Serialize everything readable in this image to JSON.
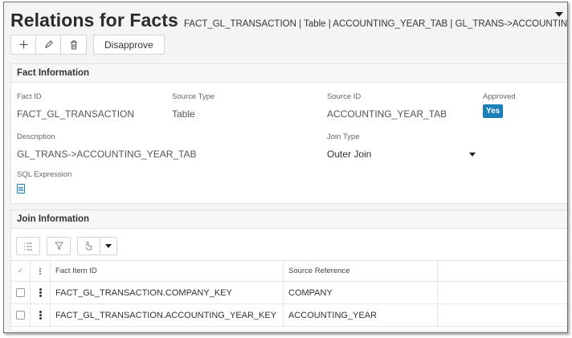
{
  "header": {
    "title": "Relations for Facts",
    "context": "FACT_GL_TRANSACTION | Table | ACCOUNTING_YEAR_TAB | GL_TRANS->ACCOUNTING_YEAR_TAB"
  },
  "toolbar": {
    "icons": [
      "plus-icon",
      "pencil-icon",
      "trash-icon"
    ],
    "disapprove_label": "Disapprove"
  },
  "fact_info": {
    "heading": "Fact Information",
    "fact_id_label": "Fact ID",
    "fact_id": "FACT_GL_TRANSACTION",
    "source_type_label": "Source Type",
    "source_type": "Table",
    "source_id_label": "Source ID",
    "source_id": "ACCOUNTING_YEAR_TAB",
    "approved_label": "Approved",
    "approved": "Yes",
    "description_label": "Description",
    "description": "GL_TRANS->ACCOUNTING_YEAR_TAB",
    "join_type_label": "Join Type",
    "join_type": "Outer Join",
    "sql_expression_label": "SQL Expression"
  },
  "join_info": {
    "heading": "Join Information",
    "columns": {
      "fact_item": "Fact Item ID",
      "source_ref": "Source Reference"
    },
    "rows": [
      {
        "fact_item": "FACT_GL_TRANSACTION.COMPANY_KEY",
        "source_ref": "COMPANY"
      },
      {
        "fact_item": "FACT_GL_TRANSACTION.ACCOUNTING_YEAR_KEY",
        "source_ref": "ACCOUNTING_YEAR"
      }
    ]
  },
  "colors": {
    "accent": "#1a7fb6",
    "panel_header_bg": "#f7f7f7",
    "page_bg": "#f4f4f4"
  }
}
